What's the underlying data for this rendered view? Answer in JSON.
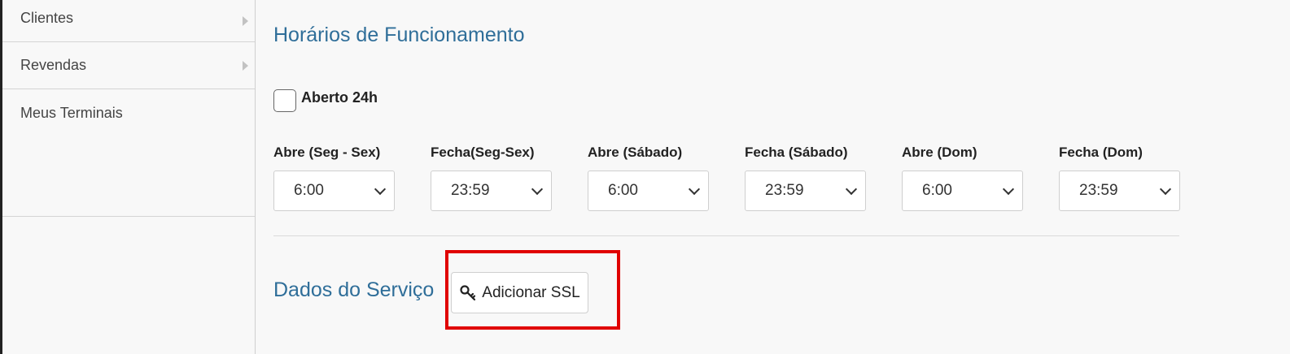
{
  "sidebar": {
    "items": [
      {
        "label": "Clientes",
        "has_submenu": true
      },
      {
        "label": "Revendas",
        "has_submenu": true
      },
      {
        "label": "Meus Terminais",
        "has_submenu": false
      }
    ]
  },
  "hours": {
    "title": "Horários de Funcionamento",
    "open24_label": "Aberto 24h",
    "open24_checked": false,
    "fields": [
      {
        "label": "Abre (Seg - Sex)",
        "value": "6:00"
      },
      {
        "label": "Fecha(Seg-Sex)",
        "value": "23:59"
      },
      {
        "label": "Abre (Sábado)",
        "value": "6:00"
      },
      {
        "label": "Fecha (Sábado)",
        "value": "23:59"
      },
      {
        "label": "Abre (Dom)",
        "value": "6:00"
      },
      {
        "label": "Fecha (Dom)",
        "value": "23:59"
      }
    ]
  },
  "service": {
    "title": "Dados do Serviço",
    "ssl_button_label": "Adicionar SSL",
    "ssl_button_icon": "key-icon",
    "highlight_color": "#e00000"
  },
  "colors": {
    "accent": "#2f6e99"
  }
}
